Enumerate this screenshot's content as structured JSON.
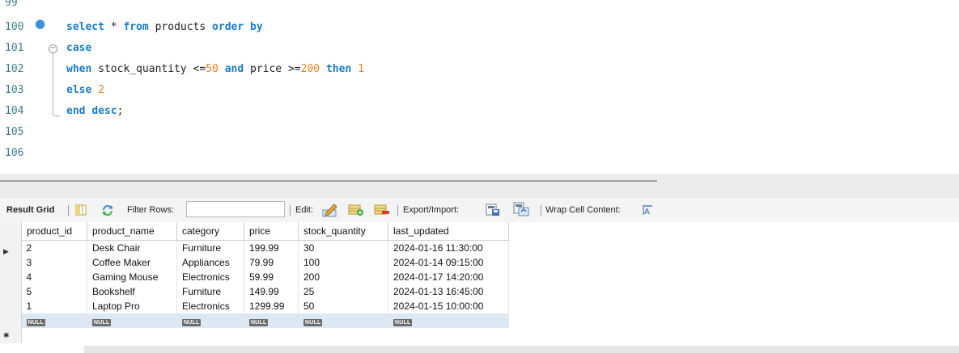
{
  "editor": {
    "lines": [
      {
        "num": "99"
      },
      {
        "num": "100",
        "tokens": [
          {
            "t": "select",
            "c": "kw"
          },
          {
            "t": " * ",
            "c": "op"
          },
          {
            "t": "from",
            "c": "kw"
          },
          {
            "t": " products ",
            "c": "id"
          },
          {
            "t": "order",
            "c": "kw"
          },
          {
            "t": " ",
            "c": "id"
          },
          {
            "t": "by",
            "c": "kw"
          }
        ]
      },
      {
        "num": "101",
        "tokens": [
          {
            "t": "case",
            "c": "kw"
          }
        ]
      },
      {
        "num": "102",
        "tokens": [
          {
            "t": "when",
            "c": "kw"
          },
          {
            "t": " stock_quantity <=",
            "c": "id"
          },
          {
            "t": "50",
            "c": "num"
          },
          {
            "t": " ",
            "c": "id"
          },
          {
            "t": "and",
            "c": "kw"
          },
          {
            "t": " price >=",
            "c": "id"
          },
          {
            "t": "200",
            "c": "num"
          },
          {
            "t": " ",
            "c": "id"
          },
          {
            "t": "then",
            "c": "kw"
          },
          {
            "t": " ",
            "c": "id"
          },
          {
            "t": "1",
            "c": "num"
          }
        ]
      },
      {
        "num": "103",
        "tokens": [
          {
            "t": "else",
            "c": "kw"
          },
          {
            "t": " ",
            "c": "id"
          },
          {
            "t": "2",
            "c": "num"
          }
        ]
      },
      {
        "num": "104",
        "tokens": [
          {
            "t": "end",
            "c": "kw"
          },
          {
            "t": " ",
            "c": "id"
          },
          {
            "t": "desc",
            "c": "kw"
          },
          {
            "t": ";",
            "c": "op"
          }
        ]
      },
      {
        "num": "105"
      },
      {
        "num": "106"
      }
    ]
  },
  "toolbar": {
    "result_grid": "Result Grid",
    "filter_rows": "Filter Rows:",
    "edit": "Edit:",
    "export_import": "Export/Import:",
    "wrap_cell_content": "Wrap Cell Content:"
  },
  "grid": {
    "columns": [
      "product_id",
      "product_name",
      "category",
      "price",
      "stock_quantity",
      "last_updated"
    ],
    "rows": [
      [
        "2",
        "Desk Chair",
        "Furniture",
        "199.99",
        "30",
        "2024-01-16 11:30:00"
      ],
      [
        "3",
        "Coffee Maker",
        "Appliances",
        "79.99",
        "100",
        "2024-01-14 09:15:00"
      ],
      [
        "4",
        "Gaming Mouse",
        "Electronics",
        "59.99",
        "200",
        "2024-01-17 14:20:00"
      ],
      [
        "5",
        "Bookshelf",
        "Furniture",
        "149.99",
        "25",
        "2024-01-13 16:45:00"
      ],
      [
        "1",
        "Laptop Pro",
        "Electronics",
        "1299.99",
        "50",
        "2024-01-15 10:00:00"
      ]
    ],
    "null_label": "NULL"
  },
  "colors": {
    "keyword": "#1a7cc4",
    "number": "#e0822a",
    "line_number": "#3f7f8f"
  }
}
